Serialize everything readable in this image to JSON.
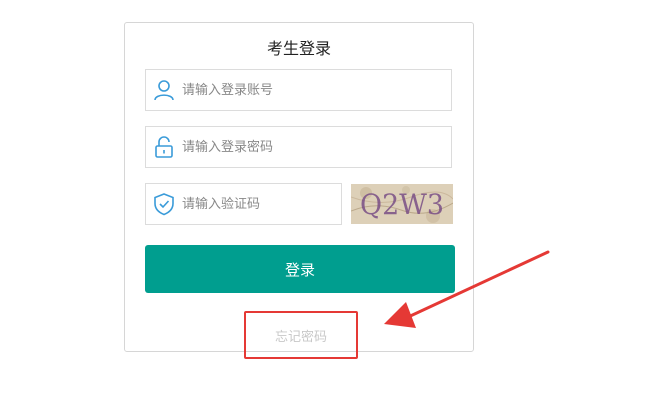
{
  "login": {
    "title": "考生登录",
    "username_placeholder": "请输入登录账号",
    "password_placeholder": "请输入登录密码",
    "captcha_placeholder": "请输入验证码",
    "captcha_text": "Q2W3",
    "submit_label": "登录",
    "forgot_label": "忘记密码"
  },
  "icons": {
    "user": "user-icon",
    "lock": "lock-icon",
    "shield": "shield-check-icon"
  },
  "colors": {
    "accent": "#009e8f",
    "icon": "#3a9bd9",
    "highlight": "#e53935"
  }
}
